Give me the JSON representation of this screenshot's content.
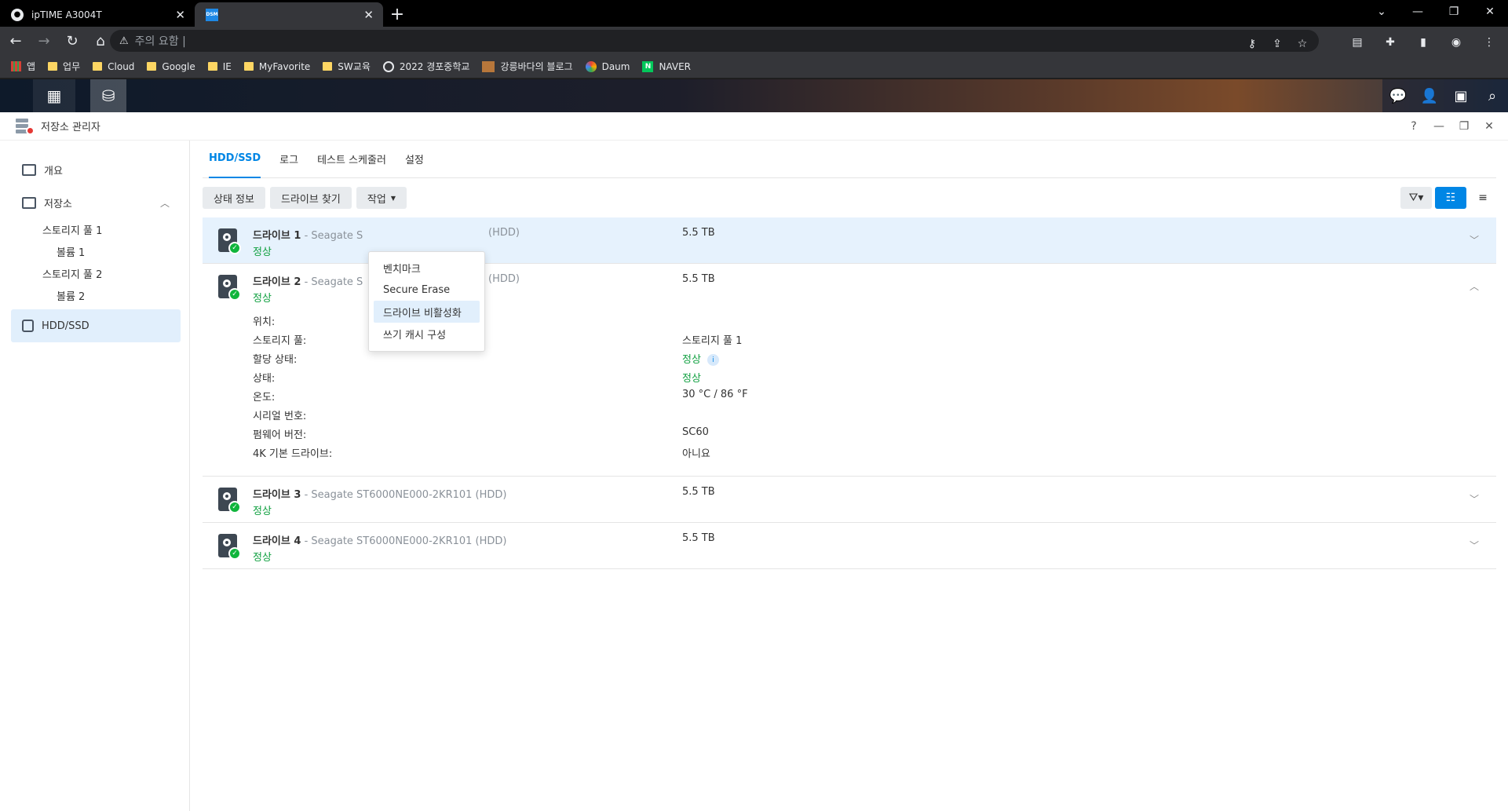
{
  "browser": {
    "tabs": [
      {
        "title": "ipTIME A3004T",
        "close": "✕"
      },
      {
        "title": "",
        "favicon": "DSM",
        "close": "✕"
      }
    ],
    "new_tab": "+",
    "address": "주의 요함 |",
    "bookmarks": [
      {
        "label": "앱",
        "icon": "apps-icon"
      },
      {
        "label": "업무",
        "icon": "folder-icon"
      },
      {
        "label": "Cloud",
        "icon": "folder-icon"
      },
      {
        "label": "Google",
        "icon": "folder-icon"
      },
      {
        "label": "IE",
        "icon": "folder-icon"
      },
      {
        "label": "MyFavorite",
        "icon": "folder-icon"
      },
      {
        "label": "SW교육",
        "icon": "folder-icon"
      },
      {
        "label": "2022 경포중학교",
        "icon": "globe-icon"
      },
      {
        "label": "강릉바다의 블로그",
        "icon": "blog-icon"
      },
      {
        "label": "Daum",
        "icon": "daum-icon"
      },
      {
        "label": "NAVER",
        "icon": "naver-icon"
      }
    ]
  },
  "app": {
    "title": "저장소 관리자",
    "help": "?"
  },
  "sidebar": {
    "items": [
      {
        "label": "개요"
      },
      {
        "label": "저장소"
      },
      {
        "label": "스토리지 풀 1"
      },
      {
        "label": "볼륨 1"
      },
      {
        "label": "스토리지 풀 2"
      },
      {
        "label": "볼륨 2"
      },
      {
        "label": "HDD/SSD"
      }
    ]
  },
  "tabs": [
    "HDD/SSD",
    "로그",
    "테스트 스케줄러",
    "설정"
  ],
  "actions": {
    "status": "상태 정보",
    "find": "드라이브 찾기",
    "action": "작업"
  },
  "menu": [
    "벤치마크",
    "Secure Erase",
    "드라이브 비활성화",
    "쓰기 캐시 구성"
  ],
  "drives": [
    {
      "label": "드라이브 1",
      "model": "- Seagate S",
      "model_tail": "(HDD)",
      "status": "정상",
      "size": "5.5 TB"
    },
    {
      "label": "드라이브 2",
      "model": "- Seagate S",
      "model_tail": "(HDD)",
      "status": "정상",
      "size": "5.5 TB"
    },
    {
      "label": "드라이브 3",
      "model": "- Seagate ST6000NE000-2KR101 (HDD)",
      "status": "정상",
      "size": "5.5 TB"
    },
    {
      "label": "드라이브 4",
      "model": "- Seagate ST6000NE000-2KR101 (HDD)",
      "status": "정상",
      "size": "5.5 TB"
    }
  ],
  "details": {
    "location": {
      "label": "위치:",
      "value": ""
    },
    "pool": {
      "label": "스토리지 풀:",
      "value": "스토리지 풀 1"
    },
    "alloc": {
      "label": "할당 상태:",
      "value": "정상"
    },
    "state": {
      "label": "상태:",
      "value": "정상"
    },
    "temp": {
      "label": "온도:",
      "value": "30 °C / 86 °F"
    },
    "serial": {
      "label": "시리얼 번호:",
      "value": ""
    },
    "firmware": {
      "label": "펌웨어 버전:",
      "value": "SC60"
    },
    "native4k": {
      "label": "4K 기본 드라이브:",
      "value": "아니요"
    }
  },
  "colors": {
    "accent": "#0086e5",
    "ok": "#10a040",
    "selected_row": "#e6f2fd"
  }
}
